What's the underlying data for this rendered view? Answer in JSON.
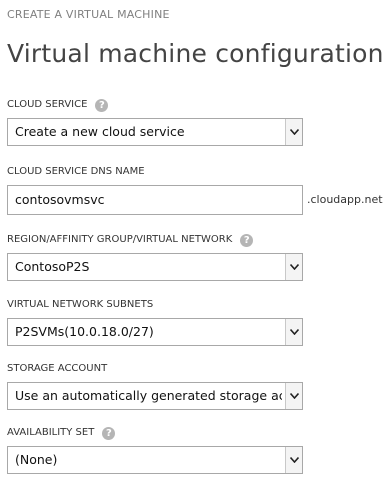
{
  "header": {
    "step_title": "CREATE A VIRTUAL MACHINE",
    "page_title": "Virtual machine configuration"
  },
  "fields": {
    "cloud_service": {
      "label": "CLOUD SERVICE",
      "value": "Create a new cloud service",
      "help_icon": "?"
    },
    "dns_name": {
      "label": "CLOUD SERVICE DNS NAME",
      "value": "contosovmsvc",
      "suffix": ".cloudapp.net"
    },
    "region": {
      "label": "REGION/AFFINITY GROUP/VIRTUAL NETWORK",
      "value": "ContosoP2S",
      "help_icon": "?"
    },
    "subnets": {
      "label": "VIRTUAL NETWORK SUBNETS",
      "value": "P2SVMs(10.0.18.0/27)"
    },
    "storage": {
      "label": "STORAGE ACCOUNT",
      "value": "Use an automatically generated storage account"
    },
    "availability": {
      "label": "AVAILABILITY SET",
      "value": "(None)",
      "help_icon": "?"
    }
  },
  "icons": {
    "help": "question-circle-icon",
    "dropdown": "chevron-down-icon"
  }
}
